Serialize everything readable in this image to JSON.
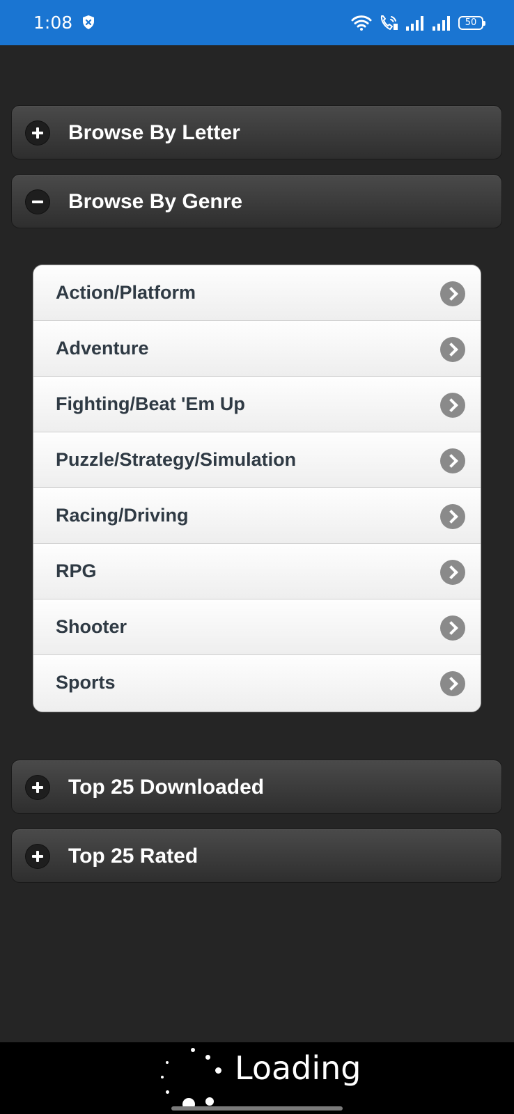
{
  "status_bar": {
    "time": "1:08",
    "battery": "50",
    "icons": [
      "shield-icon",
      "wifi-icon",
      "volte-call-icon",
      "signal-icon",
      "signal-icon",
      "battery-icon"
    ]
  },
  "sections": {
    "browse_letter": {
      "label": "Browse By Letter",
      "state": "collapsed"
    },
    "browse_genre": {
      "label": "Browse By Genre",
      "state": "expanded"
    },
    "top_downloaded": {
      "label": "Top 25 Downloaded",
      "state": "collapsed"
    },
    "top_rated": {
      "label": "Top 25 Rated",
      "state": "collapsed"
    }
  },
  "genres": [
    {
      "label": "Action/Platform"
    },
    {
      "label": "Adventure"
    },
    {
      "label": "Fighting/Beat 'Em Up"
    },
    {
      "label": "Puzzle/Strategy/Simulation"
    },
    {
      "label": "Racing/Driving"
    },
    {
      "label": "RPG"
    },
    {
      "label": "Shooter"
    },
    {
      "label": "Sports"
    }
  ],
  "loading": {
    "text": "Loading"
  },
  "colors": {
    "status_bar": "#1a75d2",
    "background": "#252525",
    "list_text": "#2f3a44",
    "arrow": "#8a8a8a"
  }
}
